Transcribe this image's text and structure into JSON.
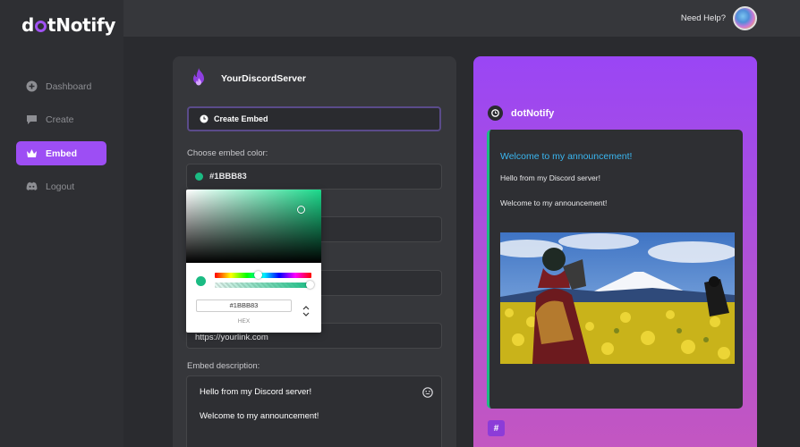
{
  "app": {
    "logo_pre": "d",
    "logo_post": "tNotify"
  },
  "sidebar": {
    "items": [
      {
        "label": "Dashboard",
        "icon": "plus-circle-icon"
      },
      {
        "label": "Create",
        "icon": "chat-bubble-icon"
      },
      {
        "label": "Embed",
        "icon": "crown-icon",
        "active": true
      },
      {
        "label": "Logout",
        "icon": "discord-icon"
      }
    ]
  },
  "header": {
    "help": "Need Help?"
  },
  "editor": {
    "server_name": "YourDiscordServer",
    "create_label": "Create Embed",
    "color_label": "Choose embed color:",
    "color_value": "#1BBB83",
    "url_value": "https://yourlink.com",
    "description_label": "Embed description:",
    "description_lines": [
      "Hello from my Discord server!",
      "Welcome to my announcement!"
    ]
  },
  "picker": {
    "hex": "#1BBB83",
    "mode": "HEX"
  },
  "preview": {
    "title": "dotNotify",
    "embed_title": "Welcome to my announcement!",
    "lines": [
      "Hello from my Discord server!",
      "Welcome to my announcement!"
    ],
    "hash_label": "#"
  },
  "colors": {
    "accent": "#9d4ef4",
    "embed": "#1BBB83",
    "link": "#3ab6f0"
  }
}
